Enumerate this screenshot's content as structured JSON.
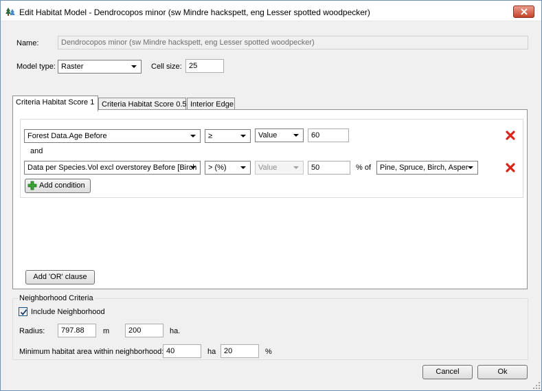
{
  "window": {
    "title": "Edit Habitat Model - Dendrocopos minor (sw Mindre hackspett, eng Lesser spotted woodpecker)"
  },
  "form": {
    "name_label": "Name:",
    "name_value": "Dendrocopos minor (sw Mindre hackspett, eng Lesser spotted woodpecker)",
    "model_type_label": "Model type:",
    "model_type_value": "Raster",
    "cell_size_label": "Cell size:",
    "cell_size_value": "25"
  },
  "tabs": [
    {
      "label": "Criteria Habitat Score 1",
      "active": true
    },
    {
      "label": "Criteria Habitat Score 0.5",
      "active": false
    },
    {
      "label": "Interior Edge",
      "active": false
    }
  ],
  "conditions": [
    {
      "field": "Forest Data.Age Before",
      "operator": "≥",
      "value_type": "Value",
      "value": "60"
    },
    {
      "field": "Data per Species.Vol excl overstorey Before [Birch",
      "operator": "> (%)",
      "value_type": "Value",
      "value": "50",
      "percent_of_label": "% of",
      "percent_of_value": "Pine, Spruce, Birch, Asper"
    }
  ],
  "and_label": "and",
  "add_condition_label": "Add condition",
  "add_or_clause_label": "Add 'OR' clause",
  "neighborhood": {
    "group_title": "Neighborhood Criteria",
    "include_label": "Include Neighborhood",
    "include_checked": true,
    "radius_label": "Radius:",
    "radius_value": "797.88",
    "radius_unit": "m",
    "area_value": "200",
    "area_unit": "ha.",
    "min_area_label": "Minimum habitat area within neighborhood:",
    "min_area_value": "40",
    "min_area_unit": "ha",
    "min_percent_value": "20",
    "min_percent_unit": "%"
  },
  "buttons": {
    "cancel_label": "Cancel",
    "ok_label": "Ok"
  },
  "colors": {
    "delete_icon": "#d9261c",
    "add_icon": "#3aa335"
  }
}
